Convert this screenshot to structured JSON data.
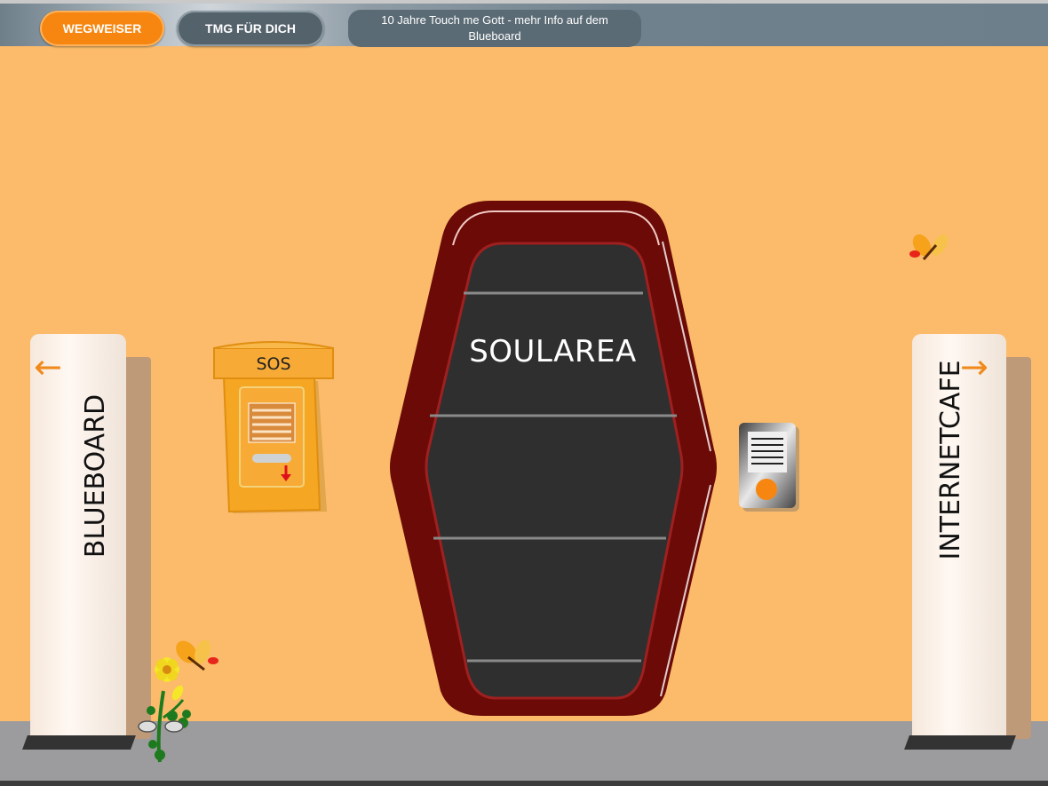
{
  "nav": {
    "wegweiser_label": "WEGWEISER",
    "tmg_label": "TMG FÜR DICH",
    "news_text": "10 Jahre Touch me Gott - mehr Info auf dem Blueboard"
  },
  "scene": {
    "left_sign": {
      "label": "BLUEBOARD",
      "arrow_icon": "arrow-left-icon"
    },
    "right_sign": {
      "label": "INTERNETCAFE",
      "arrow_icon": "arrow-right-icon"
    },
    "sos_box": {
      "label": "SOS"
    },
    "door": {
      "label": "SOULAREA"
    },
    "intercom": {
      "icon": "intercom-icon"
    }
  },
  "colors": {
    "wall": "#fbbb6a",
    "accent_orange": "#f6860f",
    "door_frame": "#6b0a06",
    "door_panel": "#2f2f2f",
    "floor": "#9c9b9d"
  }
}
